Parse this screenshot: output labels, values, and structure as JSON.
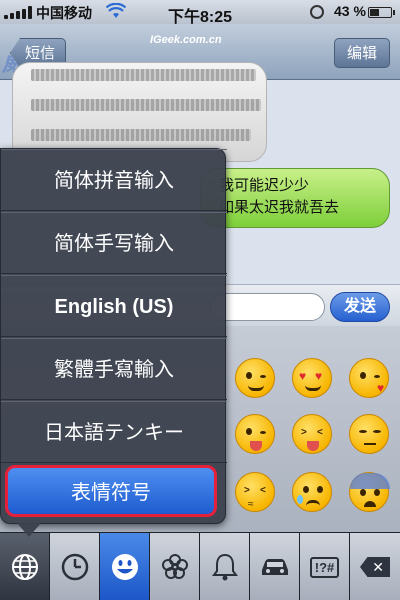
{
  "status": {
    "carrier": "中国移动",
    "time": "下午8:25",
    "battery": "43 %",
    "battery_level": 0.43
  },
  "nav": {
    "back_label": "短信",
    "edit_label": "编辑",
    "site": "IGeek.com.cn",
    "watermark": "威锋"
  },
  "messages": {
    "outgoing_lines": [
      "我可能迟少少",
      "如果太迟我就吾去"
    ]
  },
  "input": {
    "send_label": "发送"
  },
  "input_methods": [
    {
      "label": "简体拼音输入",
      "selected": false
    },
    {
      "label": "简体手写输入",
      "selected": false
    },
    {
      "label": "English (US)",
      "selected": false
    },
    {
      "label": "繁體手寫輸入",
      "selected": false
    },
    {
      "label": "日本語テンキー",
      "selected": false
    },
    {
      "label": "表情符号",
      "selected": true
    }
  ],
  "emoji_categories": [
    {
      "name": "globe-icon",
      "glyph": "🌐"
    },
    {
      "name": "clock-icon",
      "glyph": "◷"
    },
    {
      "name": "smiley-icon",
      "glyph": "☻"
    },
    {
      "name": "flower-icon",
      "glyph": "✿"
    },
    {
      "name": "bell-icon",
      "glyph": "🔔"
    },
    {
      "name": "car-icon",
      "glyph": "🚗"
    },
    {
      "name": "symbols-icon",
      "glyph": "!?#"
    }
  ],
  "colors": {
    "active_tab": "#1c56c8",
    "selected_border": "#e4203a",
    "outgoing_bubble": "#7dcf3a",
    "send_button": "#2660d0"
  }
}
